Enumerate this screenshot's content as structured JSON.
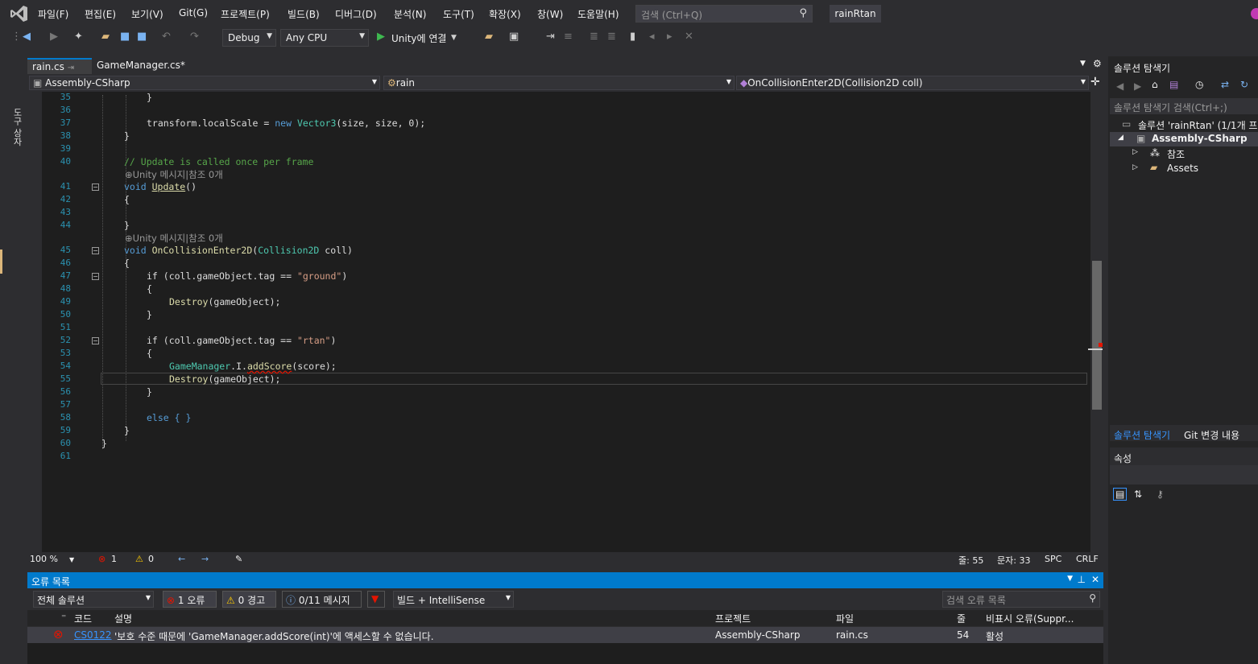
{
  "menu": [
    "파일(F)",
    "편집(E)",
    "보기(V)",
    "Git(G)",
    "프로젝트(P)",
    "빌드(B)",
    "디버그(D)",
    "분석(N)",
    "도구(T)",
    "확장(X)",
    "창(W)",
    "도움말(H)"
  ],
  "search": {
    "placeholder": "검색 (Ctrl+Q)"
  },
  "solution_name": "rainRtan",
  "toolbar": {
    "config": "Debug",
    "platform": "Any CPU",
    "run_label": "Unity에 연결"
  },
  "left_tab": "도구 상자",
  "tabs": [
    {
      "label": "rain.cs",
      "pin": "⇥"
    },
    {
      "label": "GameManager.cs*"
    }
  ],
  "nav": {
    "project": "Assembly-CSharp",
    "class": "rain",
    "member": "OnCollisionEnter2D(Collision2D coll)"
  },
  "hints": {
    "h1": "⊕Unity 메시지|참조 0개",
    "h2": "⊕Unity 메시지|참조 0개"
  },
  "line_numbers": [
    "35",
    "36",
    "37",
    "38",
    "39",
    "40",
    "41",
    "42",
    "43",
    "44",
    "45",
    "46",
    "47",
    "48",
    "49",
    "50",
    "51",
    "52",
    "53",
    "54",
    "55",
    "56",
    "57",
    "58",
    "59",
    "60",
    "61"
  ],
  "code": {
    "l35": "}",
    "l37a": "transform.localScale = ",
    "l37b": "new ",
    "l37c": "Vector3",
    "l37d": "(size, size, 0);",
    "l38": "}",
    "l40": "// Update is called once per frame",
    "l41a": "void ",
    "l41b": "Update",
    "l41c": "()",
    "l42": "{",
    "l44": "}",
    "l45a": "void ",
    "l45b": "OnCollisionEnter2D",
    "l45c": "(",
    "l45d": "Collision2D",
    "l45e": " coll)",
    "l46": "{",
    "l47a": "if (coll.gameObject.tag == ",
    "l47b": "\"ground\"",
    "l47c": ")",
    "l48": "{",
    "l49a": "Destroy",
    "l49b": "(gameObject);",
    "l50": "}",
    "l52a": "if (coll.gameObject.tag == ",
    "l52b": "\"rtan\"",
    "l52c": ")",
    "l53": "{",
    "l54a": "GameManager",
    "l54b": ".I.",
    "l54c": "addScore",
    "l54d": "(score);",
    "l55a": "Destroy",
    "l55b": "(gameObject);",
    "l56": "}",
    "l58": "else { }",
    "l59": "}",
    "l60": "}"
  },
  "status": {
    "zoom": "100 %",
    "errors": "1",
    "warnings": "0",
    "line": "줄: 55",
    "char": "문자: 33",
    "spc": "SPC",
    "crlf": "CRLF"
  },
  "error_list": {
    "title": "오류 목록",
    "scope": "전체 솔루션",
    "err_btn": "1 오류",
    "warn_btn": "0 경고",
    "msg_btn": "0/11 메시지",
    "source": "빌드 + IntelliSense",
    "search_placeholder": "검색 오류 목록",
    "columns": {
      "code": "코드",
      "desc": "설명",
      "project": "프로젝트",
      "file": "파일",
      "line": "줄",
      "suppress": "비표시 오류(Suppr..."
    },
    "row": {
      "code": "CS0122",
      "desc": "'보호 수준 때문에 'GameManager.addScore(int)'에 액세스할 수 없습니다.",
      "project": "Assembly-CSharp",
      "file": "rain.cs",
      "line": "54",
      "state": "활성"
    }
  },
  "solution_explorer": {
    "title": "솔루션 탐색기",
    "search": "솔루션 탐색기 검색(Ctrl+;)",
    "solution": "솔루션 'rainRtan' (1/1개 프로",
    "project": "Assembly-CSharp",
    "refs": "참조",
    "assets": "Assets",
    "tab1": "솔루션 탐색기",
    "tab2": "Git 변경 내용",
    "props": "속성"
  }
}
